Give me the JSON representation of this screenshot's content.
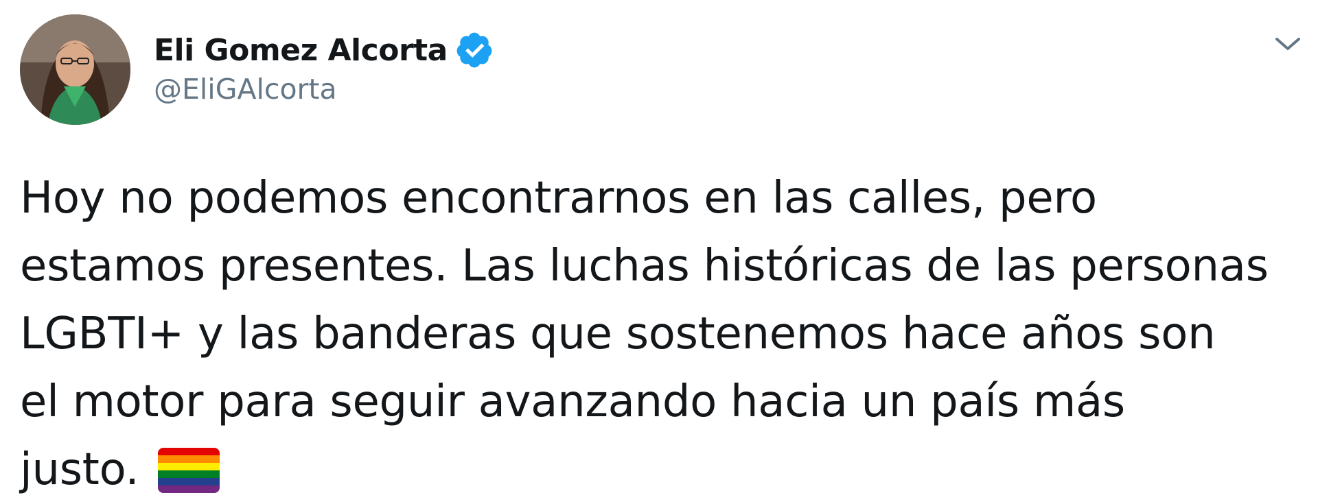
{
  "user": {
    "display_name": "Eli Gomez Alcorta",
    "handle": "@EliGAlcorta",
    "verified_icon": "verified-badge-icon",
    "avatar_icon": "profile-avatar"
  },
  "menu": {
    "icon": "chevron-down-icon"
  },
  "tweet": {
    "lines": [
      "Hoy no podemos encontrarnos en las calles, pero",
      "estamos presentes. Las luchas históricas de las personas",
      "LGBTI+ y las banderas que sostenemos hace años son",
      "el motor para seguir avanzando hacia un país más",
      "justo."
    ],
    "emoji": "rainbow-flag-emoji"
  },
  "colors": {
    "verified_blue": "#1da1f2",
    "handle_gray": "#657786",
    "text": "#14171a",
    "flag_stripes": [
      "#e40303",
      "#ff8c00",
      "#ffed00",
      "#008026",
      "#24408e",
      "#732982"
    ]
  }
}
